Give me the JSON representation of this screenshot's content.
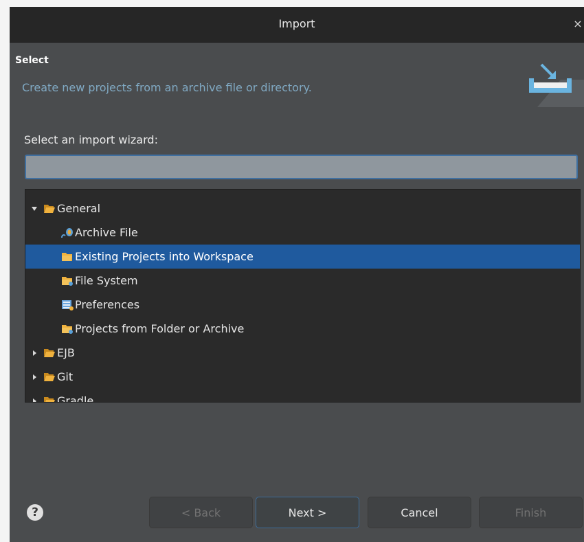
{
  "dialog": {
    "title": "Import",
    "close_glyph": "×"
  },
  "header": {
    "section_title": "Select",
    "description": "Create new projects from an archive file or directory.",
    "banner_icon": "import-wizard-icon"
  },
  "wizard": {
    "prompt": "Select an import wizard:",
    "filter_value": "",
    "tree": [
      {
        "label": "General",
        "type": "folder",
        "expanded": true
      },
      {
        "label": "Archive File",
        "type": "item",
        "icon": "archive-file-icon"
      },
      {
        "label": "Existing Projects into Workspace",
        "type": "item",
        "icon": "existing-projects-icon",
        "selected": true
      },
      {
        "label": "File System",
        "type": "item",
        "icon": "file-system-icon"
      },
      {
        "label": "Preferences",
        "type": "item",
        "icon": "preferences-icon"
      },
      {
        "label": "Projects from Folder or Archive",
        "type": "item",
        "icon": "projects-folder-icon"
      },
      {
        "label": "EJB",
        "type": "folder",
        "expanded": false
      },
      {
        "label": "Git",
        "type": "folder",
        "expanded": false
      },
      {
        "label": "Gradle",
        "type": "folder",
        "expanded": false
      }
    ]
  },
  "footer": {
    "help_glyph": "?",
    "back_label": "< Back",
    "next_label": "Next >",
    "cancel_label": "Cancel",
    "finish_label": "Finish"
  },
  "colors": {
    "dialog_bg": "#4a4c4e",
    "titlebar_bg": "#262626",
    "tree_bg": "#2a2a2a",
    "selection": "#1f5a9e",
    "link_text": "#80a9c3",
    "folder": "#e8a93a"
  }
}
